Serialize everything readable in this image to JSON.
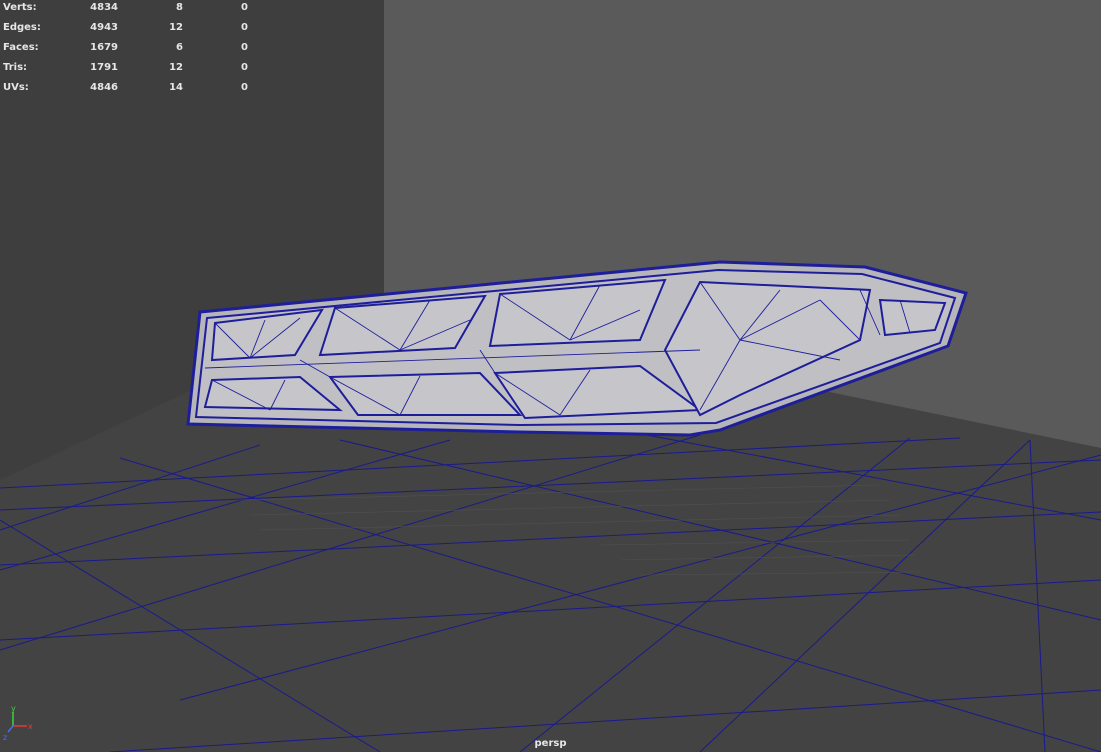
{
  "hud": {
    "rows": [
      {
        "label": "Verts:",
        "total": "4834",
        "selected": "8",
        "uv_shells": "0"
      },
      {
        "label": "Edges:",
        "total": "4943",
        "selected": "12",
        "uv_shells": "0"
      },
      {
        "label": "Faces:",
        "total": "1679",
        "selected": "6",
        "uv_shells": "0"
      },
      {
        "label": "Tris:",
        "total": "1791",
        "selected": "12",
        "uv_shells": "0"
      },
      {
        "label": "UVs:",
        "total": "4846",
        "selected": "14",
        "uv_shells": "0"
      }
    ]
  },
  "camera_label": "persp",
  "axis": {
    "y": "y",
    "x": "x",
    "z": "z"
  },
  "colors": {
    "background": "#3e3e3e",
    "back_wall": "#5a5a5a",
    "wireframe": "#1e1e9a",
    "mesh_fill": "#b4b4b8",
    "hud_text": "#e6e6e6"
  }
}
